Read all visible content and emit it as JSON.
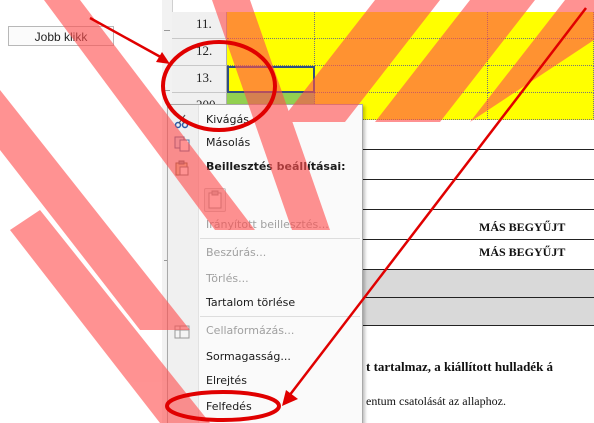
{
  "note": {
    "label": "Jobb klikk"
  },
  "rows": [
    {
      "num": "11."
    },
    {
      "num": "12."
    },
    {
      "num": "13."
    },
    {
      "num": "200"
    }
  ],
  "sheet_text": {
    "mas1": "MÁS BEGYŰJT",
    "mas2": "MÁS BEGYŰJT",
    "line1": "t tartalmaz, a kiállított hulladék á",
    "line2": "entum csatolását az allaphoz."
  },
  "menu": {
    "cut": "Kivágás",
    "copy": "Másolás",
    "paste_options": "Beillesztés beállításai:",
    "paste_special": "Irányított beillesztés...",
    "insert": "Beszúrás...",
    "delete": "Törlés...",
    "clear_contents": "Tartalom törlése",
    "format_cells": "Cellaformázás...",
    "row_height": "Sormagasság...",
    "hide": "Elrejtés",
    "unhide": "Felfedés"
  },
  "colors": {
    "yellow": "#ffff00",
    "green": "#92d050",
    "grey": "#d9d9d9",
    "stripe_red": "#ff5050",
    "stripe_orange": "#ff8000",
    "annotation_red": "#e00000"
  }
}
